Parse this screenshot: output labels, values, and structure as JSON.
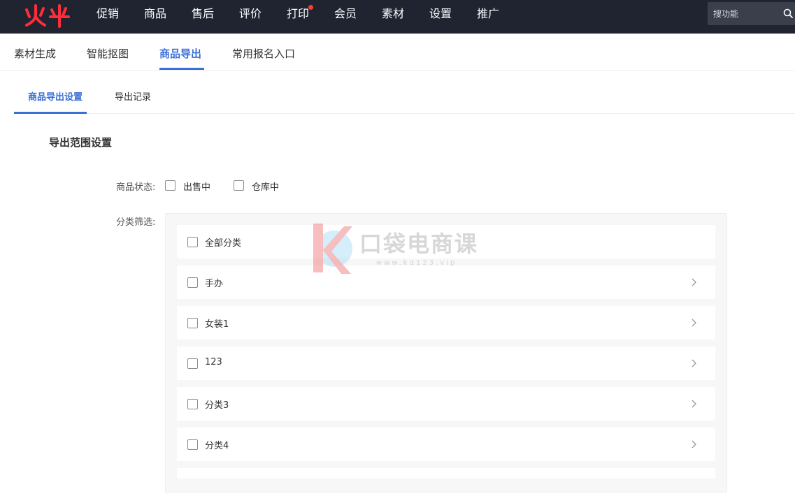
{
  "topnav": {
    "items": [
      "促销",
      "商品",
      "售后",
      "评价",
      "打印",
      "会员",
      "素材",
      "设置",
      "推广"
    ],
    "search_placeholder": "搜功能",
    "colors": {
      "background": "#1f2430",
      "logo": "#ff2d3b",
      "notification_dot": "#ff3b30"
    }
  },
  "tabs": [
    "素材生成",
    "智能抠图",
    "商品导出",
    "常用报名入口"
  ],
  "active_tab": "商品导出",
  "subtabs": [
    "商品导出设置",
    "导出记录"
  ],
  "active_subtab": "商品导出设置",
  "section_title": "导出范围设置",
  "form": {
    "status_label": "商品状态:",
    "status_options": [
      "出售中",
      "仓库中"
    ],
    "category_label": "分类筛选:",
    "categories": [
      "全部分类",
      "手办",
      "女装1",
      "123",
      "分类3",
      "分类4"
    ]
  },
  "watermark": {
    "title": "口袋电商课",
    "url": "www.kd123.vip"
  },
  "accent_color": "#3a6fd6"
}
